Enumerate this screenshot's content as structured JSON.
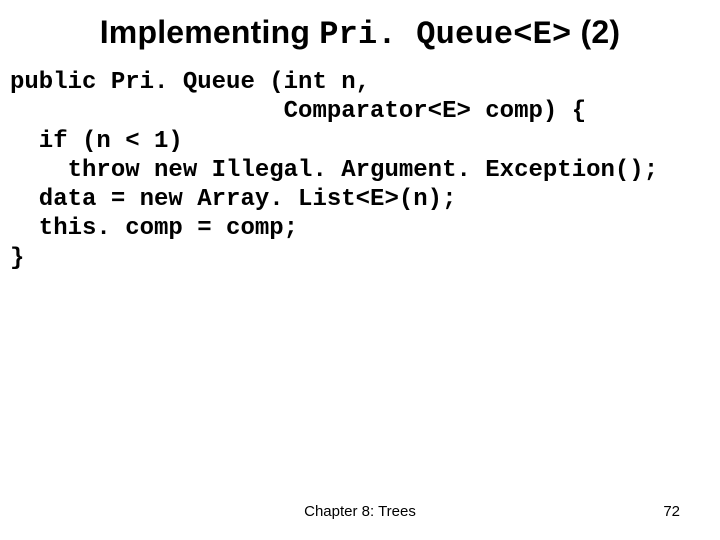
{
  "title": {
    "prefix": "Implementing ",
    "mono": "Pri. Queue<E>",
    "suffix": " (2)"
  },
  "code": {
    "l1": "public Pri. Queue (int n,",
    "l2": "                   Comparator<E> comp) {",
    "l3": "  if (n < 1)",
    "l4": "    throw new Illegal. Argument. Exception();",
    "l5": "  data = new Array. List<E>(n);",
    "l6": "  this. comp = comp;",
    "l7": "}"
  },
  "footer": {
    "chapter": "Chapter 8: Trees",
    "page": "72"
  }
}
